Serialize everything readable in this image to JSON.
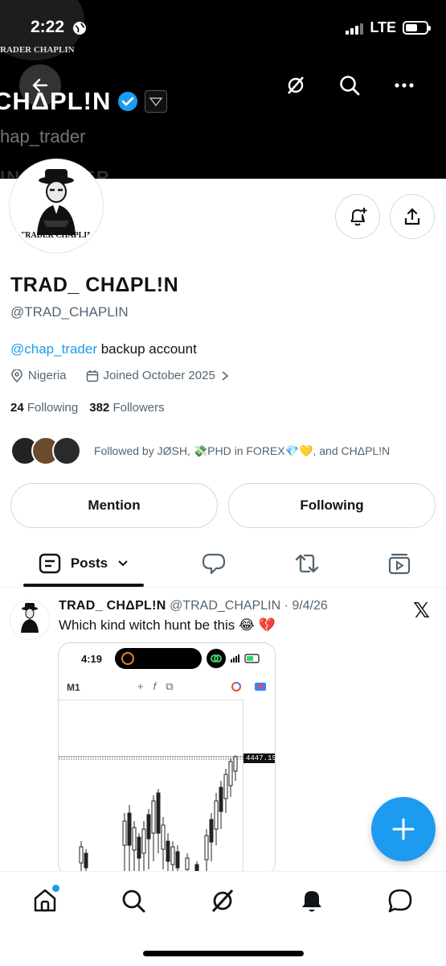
{
  "status_bar": {
    "time": "2:22",
    "network": "LTE"
  },
  "banner": {
    "ghost_text": "RADER CHAPLIN",
    "name": "CHΔPL!N",
    "handle": "hap_trader",
    "ghost_text_2": "IN TRADER"
  },
  "profile": {
    "avatar_caption": "TRADER CHAPLIN",
    "display_name": "TRAD_ CHΔPL!N",
    "handle": "@TRAD_CHAPLIN",
    "bio_link": "@chap_trader",
    "bio_text": " backup account",
    "location": "Nigeria",
    "joined": "Joined October 2025",
    "following_count": "24",
    "following_label": "Following",
    "followers_count": "382",
    "followers_label": "Followers",
    "followed_by": "Followed by JØSH, 💸PHD in FOREX💎💛, and CHΔPL!N"
  },
  "actions": {
    "mention": "Mention",
    "following": "Following"
  },
  "tabs": {
    "posts": "Posts"
  },
  "post": {
    "author": "TRAD_ CHΔPL!N",
    "meta": " @TRAD_CHAPLIN · 9/4/26",
    "text": "Which kind witch hunt be this 😂 💔",
    "media": {
      "time": "4:19",
      "timeframe": "M1",
      "price": "4447.19"
    }
  },
  "colors": {
    "accent": "#1d9bf0",
    "text": "#0f1419",
    "muted": "#536471"
  }
}
